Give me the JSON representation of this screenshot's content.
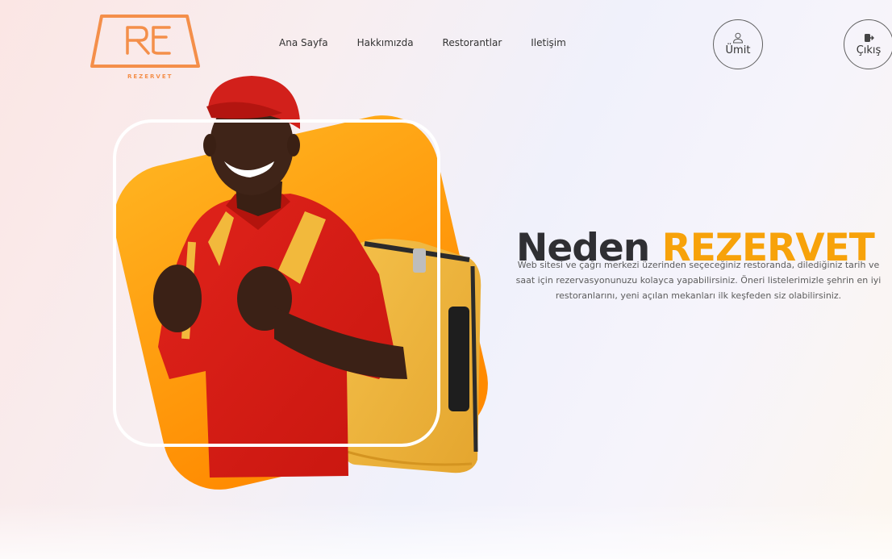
{
  "brand": {
    "logo_text": "REZERVET",
    "logo_mark": "RE",
    "accent_color": "#f7a20a",
    "logo_color": "#f48f4a"
  },
  "nav": {
    "items": [
      {
        "label": "Ana Sayfa"
      },
      {
        "label": "Hakkımızda"
      },
      {
        "label": "Restorantlar"
      },
      {
        "label": "Iletişim"
      }
    ]
  },
  "user_menu": {
    "profile_label": "Ümit",
    "profile_icon": "user-icon",
    "logout_label": "Çıkış",
    "logout_icon": "logout-icon"
  },
  "hero": {
    "title_dark": "Neden",
    "title_accent": "REZERVET",
    "description": "Web sitesi ve çağrı merkezi üzerinden seçeceğiniz restoranda, dilediğiniz tarih ve saat için rezervasyonunuzu kolayca yapabilirsiniz. Öneri listelerimizle şehrin en iyi restoranlarını, yeni açılan mekanları ilk keşfeden siz olabilirsiniz.",
    "image": "delivery-man-with-yellow-backpack-image",
    "card_color": "#ffa31a"
  }
}
